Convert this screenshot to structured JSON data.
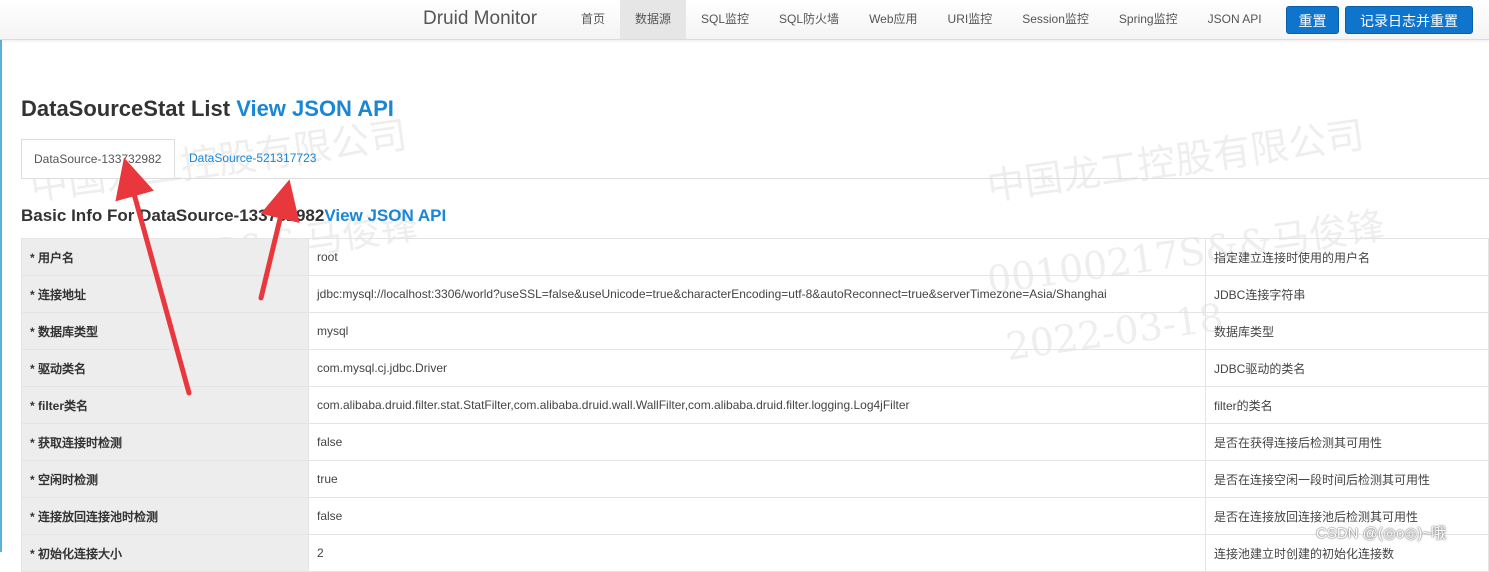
{
  "navbar": {
    "brand": "Druid Monitor",
    "items": [
      {
        "label": "首页"
      },
      {
        "label": "数据源",
        "active": true
      },
      {
        "label": "SQL监控"
      },
      {
        "label": "SQL防火墙"
      },
      {
        "label": "Web应用"
      },
      {
        "label": "URI监控"
      },
      {
        "label": "Session监控"
      },
      {
        "label": "Spring监控"
      },
      {
        "label": "JSON API"
      }
    ],
    "reset_label": "重置",
    "log_reset_label": "记录日志并重置"
  },
  "page": {
    "title": "DataSourceStat List",
    "title_link": "View JSON API",
    "tabs": [
      {
        "label": "DataSource-133732982",
        "active": true
      },
      {
        "label": "DataSource-521317723"
      }
    ],
    "basic_info_title": "Basic Info For DataSource-133732982",
    "basic_info_link": "View JSON API"
  },
  "basic_info": [
    {
      "key": "* 用户名",
      "value": "root",
      "desc": "指定建立连接时使用的用户名"
    },
    {
      "key": "* 连接地址",
      "value": "jdbc:mysql://localhost:3306/world?useSSL=false&useUnicode=true&characterEncoding=utf-8&autoReconnect=true&serverTimezone=Asia/Shanghai",
      "desc": "JDBC连接字符串"
    },
    {
      "key": "* 数据库类型",
      "value": "mysql",
      "desc": "数据库类型"
    },
    {
      "key": "* 驱动类名",
      "value": "com.mysql.cj.jdbc.Driver",
      "desc": "JDBC驱动的类名"
    },
    {
      "key": "* filter类名",
      "value": "com.alibaba.druid.filter.stat.StatFilter,com.alibaba.druid.wall.WallFilter,com.alibaba.druid.filter.logging.Log4jFilter",
      "desc": "filter的类名"
    },
    {
      "key": "* 获取连接时检测",
      "value": "false",
      "desc": "是否在获得连接后检测其可用性"
    },
    {
      "key": "* 空闲时检测",
      "value": "true",
      "desc": "是否在连接空闲一段时间后检测其可用性"
    },
    {
      "key": "* 连接放回连接池时检测",
      "value": "false",
      "desc": "是否在连接放回连接池后检测其可用性"
    },
    {
      "key": "* 初始化连接大小",
      "value": "2",
      "desc": "连接池建立时创建的初始化连接数"
    }
  ],
  "watermark": {
    "company": "中国龙工控股有限公司",
    "user": "00100217S&&马俊锋",
    "date": "2022-03-18"
  },
  "credit": "CSDN @(◎o◎)~哦",
  "colors": {
    "link": "#1a86d6",
    "button": "#0e74cc",
    "annotation_arrow": "#e8383d"
  }
}
